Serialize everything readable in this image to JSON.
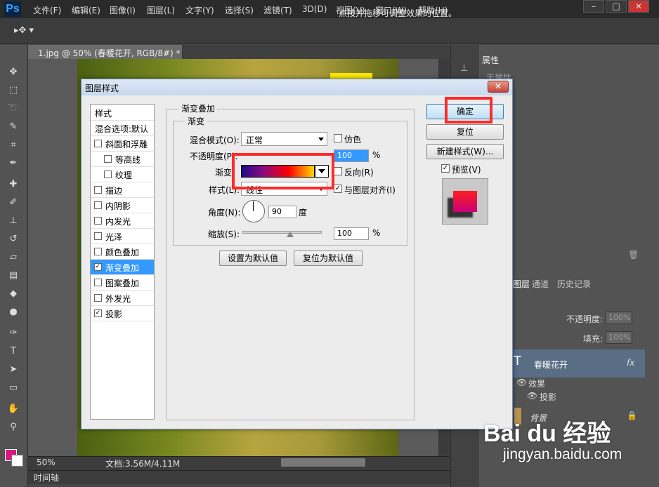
{
  "menubar": {
    "logo": "Ps",
    "items": [
      "文件(F)",
      "编辑(E)",
      "图像(I)",
      "图层(L)",
      "文字(Y)",
      "选择(S)",
      "滤镜(T)",
      "3D(D)",
      "视图(V)",
      "窗口(W)",
      "帮助(H)"
    ],
    "window_buttons": [
      "–",
      "□",
      "✕"
    ]
  },
  "options_bar": {
    "hint": "点按并拖移可调整效果的位置。"
  },
  "document": {
    "tab_title": "1.jpg @ 50% (春暖花开, RGB/8#) *",
    "tab_close": "×",
    "zoom": "50%",
    "doc_info": "文档:3.56M/4.11M",
    "timeline_label": "时间轴"
  },
  "tools": {
    "fg_color": "#d8177f",
    "bg_color": "#ffffff"
  },
  "properties_panel": {
    "tab": "属性",
    "subtitle": "无属性"
  },
  "layers_panel": {
    "tabs": [
      "图层",
      "通道",
      "历史记录"
    ],
    "opacity_label": "不透明度:",
    "opacity_value": "100%",
    "fill_label": "填充:",
    "fill_value": "100%",
    "layers": [
      {
        "name": "春暖花开",
        "type": "T",
        "fx": "fx"
      },
      {
        "name": "背景"
      }
    ],
    "effects_label": "效果",
    "effect_item": "投影"
  },
  "dialog": {
    "title": "图层样式",
    "close": "✕",
    "style_list": [
      {
        "label": "样式",
        "checkbox": false,
        "indent": false,
        "header": true
      },
      {
        "label": "混合选项:默认",
        "checkbox": false,
        "indent": false,
        "header": true
      },
      {
        "label": "斜面和浮雕",
        "checkbox": true,
        "checked": false,
        "indent": false
      },
      {
        "label": "等高线",
        "checkbox": true,
        "checked": false,
        "indent": true
      },
      {
        "label": "纹理",
        "checkbox": true,
        "checked": false,
        "indent": true
      },
      {
        "label": "描边",
        "checkbox": true,
        "checked": false,
        "indent": false
      },
      {
        "label": "内阴影",
        "checkbox": true,
        "checked": false,
        "indent": false
      },
      {
        "label": "内发光",
        "checkbox": true,
        "checked": false,
        "indent": false
      },
      {
        "label": "光泽",
        "checkbox": true,
        "checked": false,
        "indent": false
      },
      {
        "label": "颜色叠加",
        "checkbox": true,
        "checked": false,
        "indent": false
      },
      {
        "label": "渐变叠加",
        "checkbox": true,
        "checked": true,
        "indent": false,
        "selected": true
      },
      {
        "label": "图案叠加",
        "checkbox": true,
        "checked": false,
        "indent": false
      },
      {
        "label": "外发光",
        "checkbox": true,
        "checked": false,
        "indent": false
      },
      {
        "label": "投影",
        "checkbox": true,
        "checked": true,
        "indent": false
      }
    ],
    "section_title": "渐变叠加",
    "group_title": "渐变",
    "blend_mode_label": "混合模式(O):",
    "blend_mode_value": "正常",
    "dither_label": "仿色",
    "opacity_label": "不透明度(P):",
    "opacity_value": "100",
    "percent": "%",
    "gradient_label": "渐变:",
    "reverse_label": "反向(R)",
    "style_label": "样式(L):",
    "style_value": "线性",
    "align_label": "与图层对齐(I)",
    "angle_label": "角度(N):",
    "angle_value": "90",
    "angle_unit": "度",
    "scale_label": "缩放(S):",
    "scale_value": "100",
    "set_default_button": "设置为默认值",
    "reset_default_button": "复位为默认值",
    "ok_button": "确定",
    "reset_button": "复位",
    "new_style_button": "新建样式(W)...",
    "preview_label": "预览(V)",
    "gradient_colors": [
      "#1e0b8a",
      "#8a0a80",
      "#ff0000",
      "#ffd800"
    ]
  },
  "annotation_color": "#ff2a2a",
  "watermark": {
    "brand": "Bai du 经验",
    "url": "jingyan.baidu.com"
  }
}
